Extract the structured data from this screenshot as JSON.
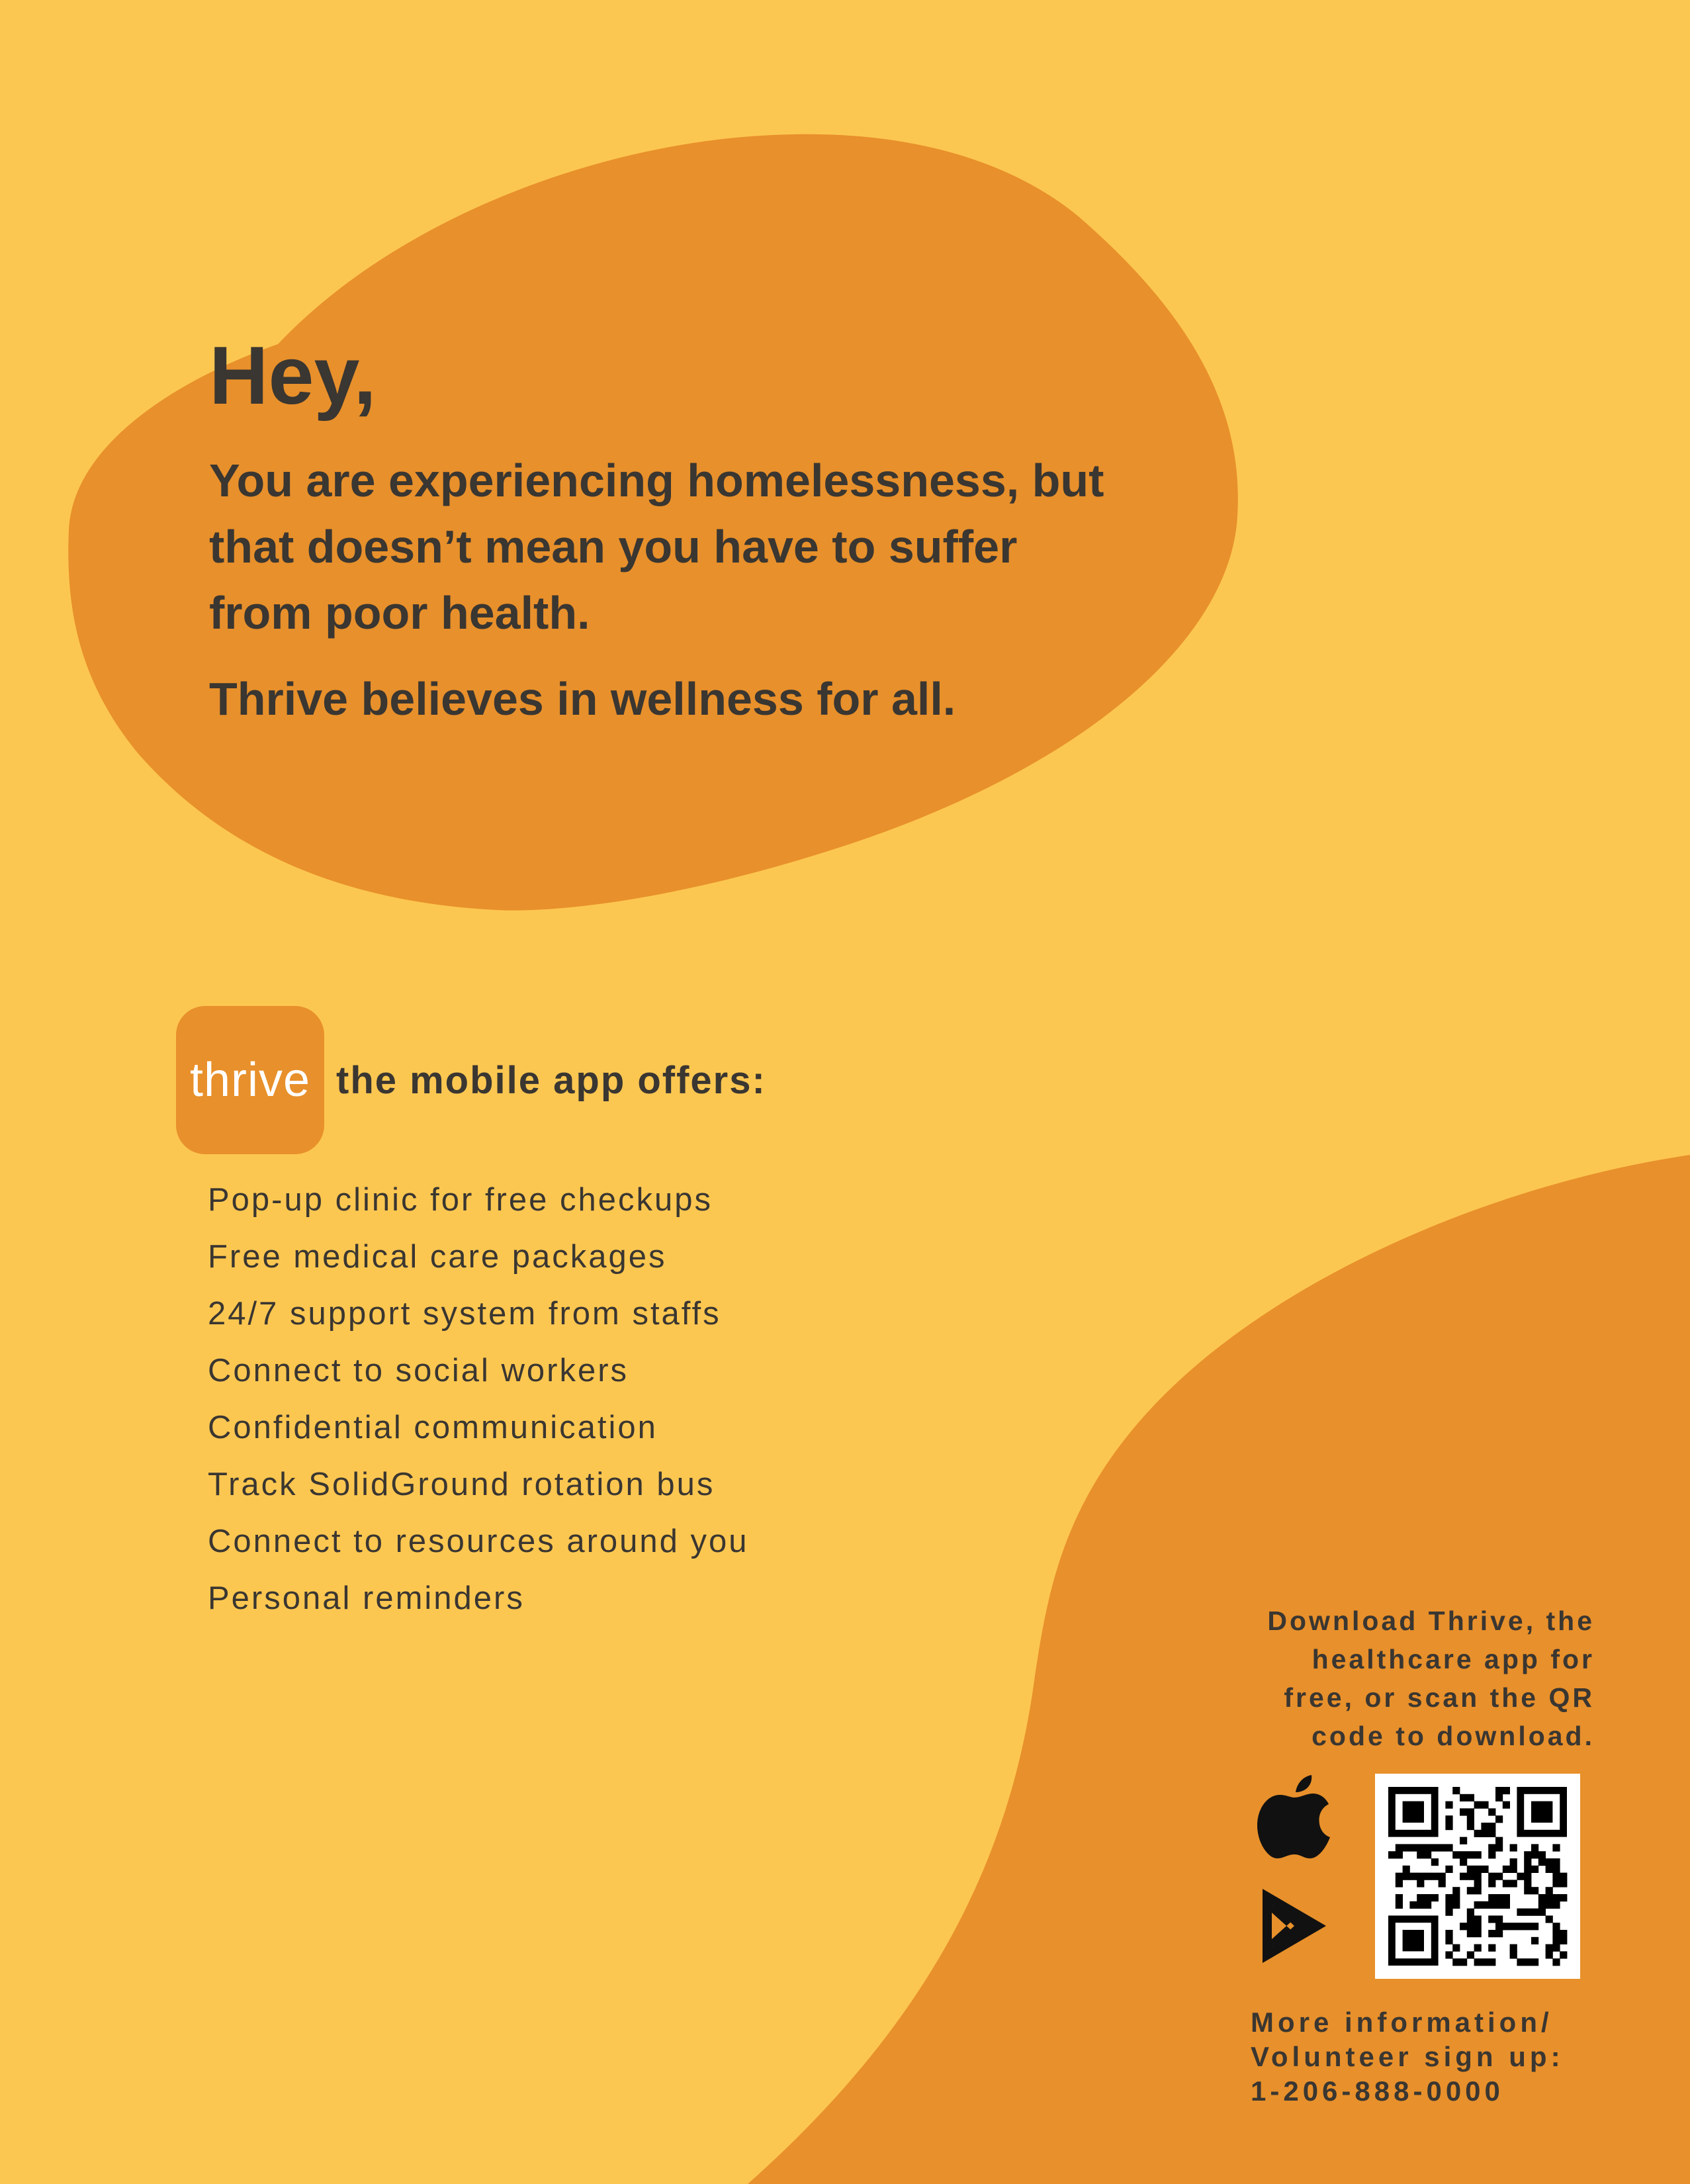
{
  "colors": {
    "background": "#fcc751",
    "accent_orange": "#e8902b",
    "text": "#3a3631"
  },
  "hero": {
    "greeting": "Hey,",
    "body_lines": [
      "You are experiencing homelessness, but",
      "that doesn’t mean you have to suffer",
      "from poor health."
    ],
    "tagline": "Thrive believes in wellness for all."
  },
  "app": {
    "logo_text": "thrive",
    "headline": "the mobile app offers:"
  },
  "features": [
    "Pop-up clinic for free checkups",
    "Free medical care packages",
    "24/7 support system from staffs",
    "Connect to social workers",
    "Confidential communication",
    "Track SolidGround rotation bus",
    "Connect to resources around you",
    "Personal reminders"
  ],
  "download": {
    "lines": [
      "Download Thrive, the",
      "healthcare app for",
      "free, or scan the QR",
      "code to download."
    ],
    "icons": [
      "apple-icon",
      "google-play-icon",
      "qr-code"
    ]
  },
  "contact": {
    "lines": [
      "More information/",
      "Volunteer sign up:",
      "1-206-888-0000"
    ]
  }
}
